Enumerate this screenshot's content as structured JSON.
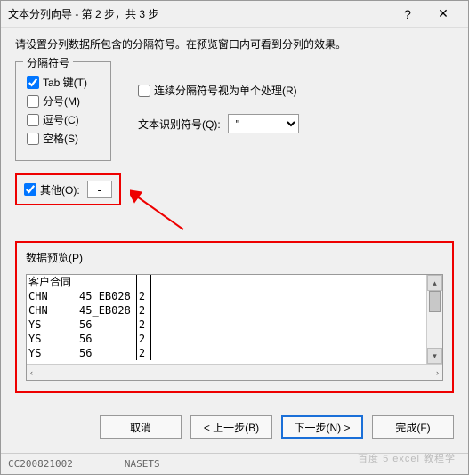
{
  "titlebar": {
    "title": "文本分列向导 - 第 2 步，共 3 步"
  },
  "instruction": "请设置分列数据所包含的分隔符号。在预览窗口内可看到分列的效果。",
  "delim": {
    "legend": "分隔符号",
    "tab": "Tab 键(T)",
    "semicolon": "分号(M)",
    "comma": "逗号(C)",
    "space": "空格(S)",
    "other": "其他(O):",
    "other_value": "-",
    "consecutive": "连续分隔符号视为单个处理(R)",
    "qualifier_label": "文本识别符号(Q):",
    "qualifier_value": "\""
  },
  "preview": {
    "label": "数据预览(P)",
    "cols": [
      "客户合同",
      "",
      ""
    ],
    "rows": [
      [
        "CHN",
        "45_EB028",
        "2"
      ],
      [
        "CHN",
        "45_EB028",
        "2"
      ],
      [
        "YS",
        "56",
        "2"
      ],
      [
        "YS",
        "56",
        "2"
      ],
      [
        "YS",
        "56",
        "2"
      ]
    ]
  },
  "buttons": {
    "cancel": "取消",
    "back": "< 上一步(B)",
    "next": "下一步(N) >",
    "finish": "完成(F)"
  },
  "footer": {
    "left": "CC200821002",
    "right": "NASETS"
  }
}
